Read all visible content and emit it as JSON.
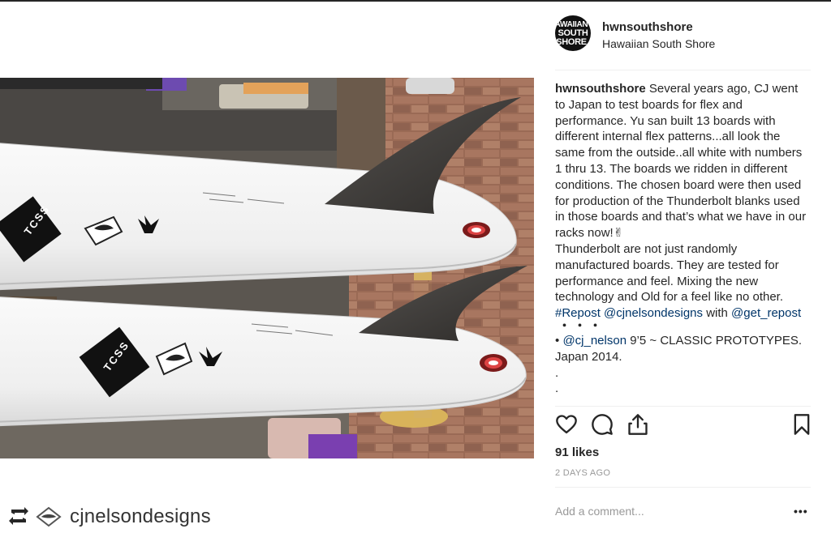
{
  "post": {
    "header": {
      "avatar_text": [
        "AWAIIAN",
        "SOUTH",
        "SHORE"
      ],
      "username": "hwnsouthshore",
      "location": "Hawaiian South Shore"
    },
    "caption": {
      "username": "hwnsouthshore",
      "text": "Several years ago, CJ went to Japan to test boards for flex and performance. Yu san built 13 boards with different internal flex patterns...all look the same from the outside..all white with numbers 1 thru 13. The boards we ridden in different conditions. The chosen board were then used for production of the Thunderbolt blanks used in those boards and that’s what we have in our racks now!✌",
      "text2": "Thunderbolt are not just randomly manufactured boards. They are tested for performance and feel. Mixing the new technology and Old for a feel like no other.",
      "repost_tag": "#Repost",
      "repost_mention": "@cjnelsondesigns",
      "with_word": "with",
      "get_repost": "@get_repost",
      "dots": "・・・",
      "bullet": "•",
      "cj_mention": "@cj_nelson",
      "cj_text": "9’5 ~ CLASSIC PROTOTYPES. Japan 2014.",
      "dot_lines": [
        ".",
        ".",
        "."
      ]
    },
    "actions": {
      "icons": [
        "heart-icon",
        "comment-icon",
        "share-icon",
        "bookmark-icon"
      ]
    },
    "likes": "91 likes",
    "date": "2 DAYS AGO",
    "comment_placeholder": "Add a comment...",
    "more_label": "•••"
  },
  "repost_bar": {
    "icon": "repost-icon",
    "logo": "cjnelson-logo",
    "username": "cjnelsondesigns"
  },
  "photo": {
    "board_stickers": [
      "TCSS",
      "TCSS"
    ],
    "description_colors": {
      "board": "#f4f4f4",
      "fin": "#3a3836",
      "brick": "#9c6a52"
    }
  }
}
